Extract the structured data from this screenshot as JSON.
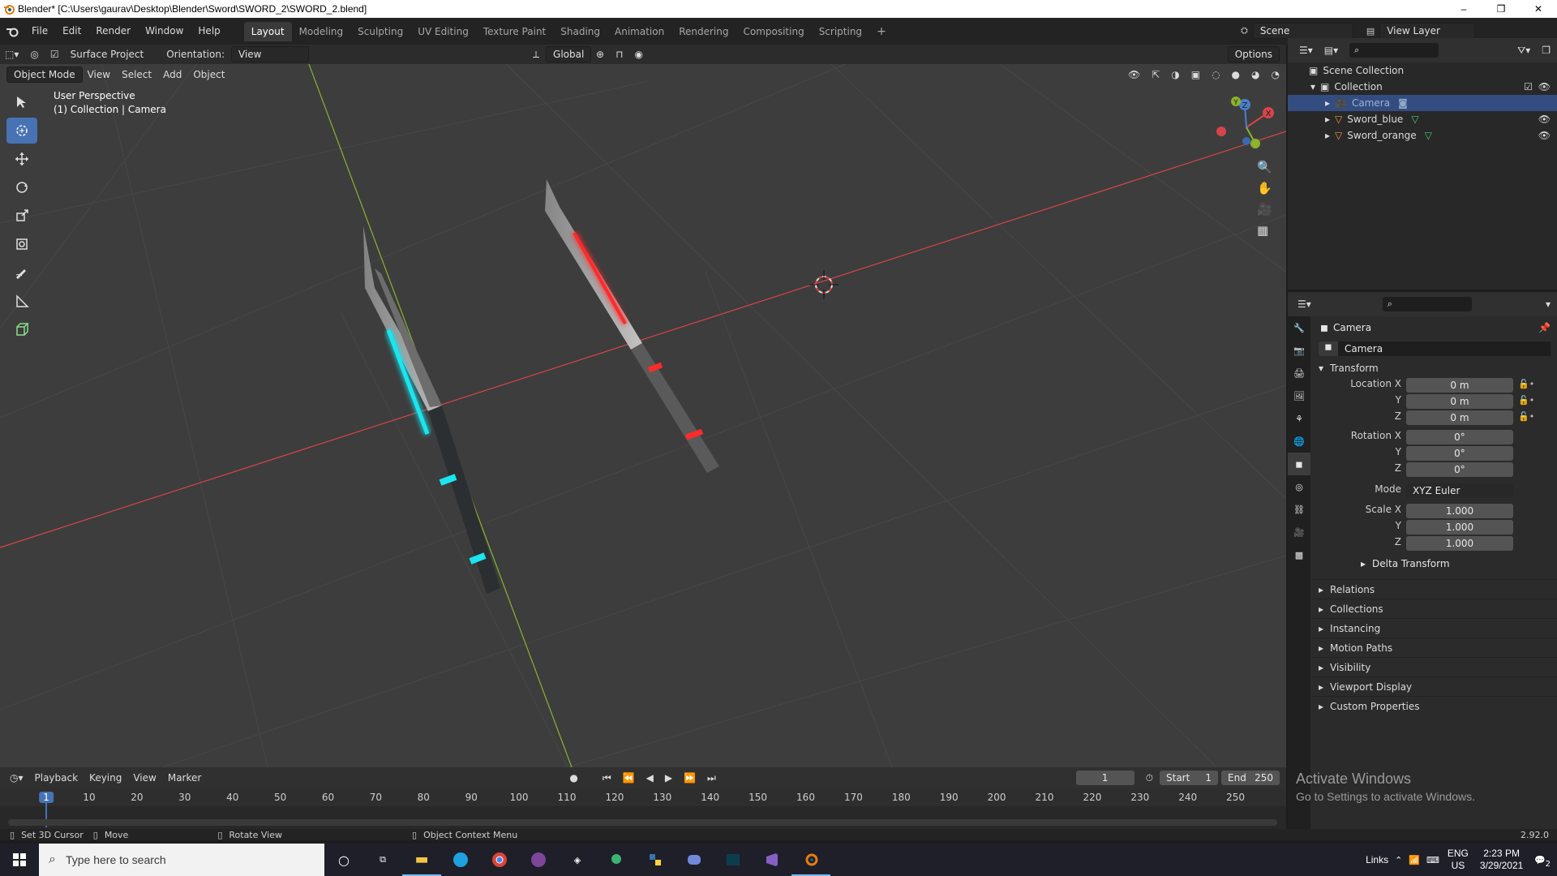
{
  "window": {
    "title": "Blender* [C:\\Users\\gaurav\\Desktop\\Blender\\Sword\\SWORD_2\\SWORD_2.blend]",
    "controls": [
      "–",
      "❐",
      "✕"
    ]
  },
  "menu": {
    "items": [
      "File",
      "Edit",
      "Render",
      "Window",
      "Help"
    ],
    "workspaces": [
      "Layout",
      "Modeling",
      "Sculpting",
      "UV Editing",
      "Texture Paint",
      "Shading",
      "Animation",
      "Rendering",
      "Compositing",
      "Scripting"
    ],
    "active_workspace": "Layout",
    "scene_label": "Scene",
    "view_layer_label": "View Layer"
  },
  "viewport_header": {
    "surface_project": "Surface Project",
    "orientation_label": "Orientation:",
    "orientation_value": "View",
    "transform_space": "Global",
    "options": "Options",
    "mode": "Object Mode",
    "menus": [
      "View",
      "Select",
      "Add",
      "Object"
    ]
  },
  "viewport": {
    "perspective_label": "User Perspective",
    "collection_label": "(1) Collection | Camera",
    "gizmo_axes": [
      "X",
      "Y",
      "Z"
    ],
    "colors": {
      "background": "#3d3d3d",
      "x_axis": "#d6454b",
      "y_axis": "#8bb32c",
      "cyan_glow": "#19e6f0",
      "red_glow": "#ff2a2a"
    }
  },
  "outliner": {
    "scene_collection": "Scene Collection",
    "collection": "Collection",
    "items": [
      {
        "name": "Camera",
        "selected": true
      },
      {
        "name": "Sword_blue",
        "selected": false
      },
      {
        "name": "Sword_orange",
        "selected": false
      }
    ]
  },
  "properties": {
    "object_name": "Camera",
    "object_field": "Camera",
    "transform_title": "Transform",
    "location": {
      "label": "Location X",
      "x": "0 m",
      "y": "0 m",
      "z": "0 m"
    },
    "rotation": {
      "label": "Rotation X",
      "x": "0°",
      "y": "0°",
      "z": "0°"
    },
    "mode_label": "Mode",
    "mode_value": "XYZ Euler",
    "scale": {
      "label": "Scale X",
      "x": "1.000",
      "y": "1.000",
      "z": "1.000"
    },
    "axis_labels": [
      "Y",
      "Z"
    ],
    "delta_transform": "Delta Transform",
    "sections": [
      "Relations",
      "Collections",
      "Instancing",
      "Motion Paths",
      "Visibility",
      "Viewport Display",
      "Custom Properties"
    ]
  },
  "timeline": {
    "menus": [
      "Playback",
      "Keying",
      "View",
      "Marker"
    ],
    "current_frame": "1",
    "start_label": "Start",
    "start_value": "1",
    "end_label": "End",
    "end_value": "250",
    "ruler": [
      "1",
      "10",
      "20",
      "30",
      "40",
      "50",
      "60",
      "70",
      "80",
      "90",
      "100",
      "110",
      "120",
      "130",
      "140",
      "150",
      "160",
      "170",
      "180",
      "190",
      "200",
      "210",
      "220",
      "230",
      "240",
      "250"
    ]
  },
  "statusbar": {
    "left": "Set 3D Cursor",
    "move": "Move",
    "rotate": "Rotate View",
    "context": "Object Context Menu",
    "version": "2.92.0"
  },
  "activate_windows": {
    "title": "Activate Windows",
    "subtitle": "Go to Settings to activate Windows."
  },
  "taskbar": {
    "search_placeholder": "Type here to search",
    "links": "Links",
    "lang": "ENG",
    "region": "US",
    "time": "2:23 PM",
    "date": "3/29/2021",
    "notifications": "2"
  }
}
